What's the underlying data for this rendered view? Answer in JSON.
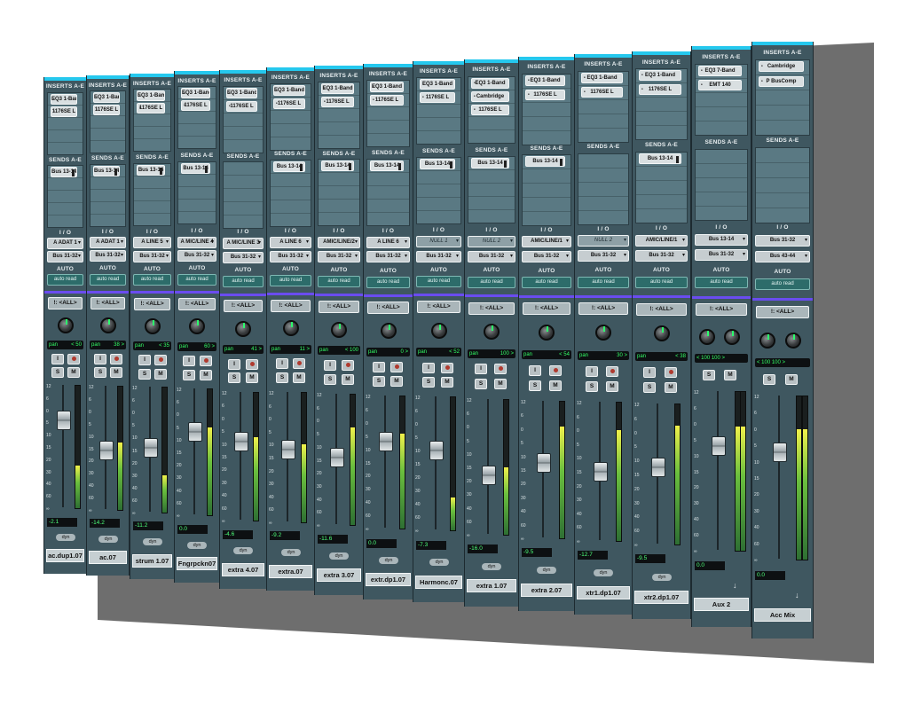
{
  "labels": {
    "inserts": "INSERTS A-E",
    "sends": "SENDS A-E",
    "io": "I / O",
    "auto": "AUTO",
    "auto_mode": "auto read",
    "group": "!: <ALL>",
    "pan": "pan",
    "solo": "S",
    "mute": "M",
    "input": "I",
    "dyn": "dyn"
  },
  "colors": {
    "strip_bg": "#3f5760",
    "header_accent": "#25c8ee",
    "separator": "#6a4cf0",
    "display_text": "#33ff66"
  },
  "channels": [
    {
      "name": "ac.dup1.07",
      "inserts": [
        "EQ3 1-Band",
        "1176SE L"
      ],
      "send": "Bus 13-14",
      "io_in": "A ADAT 1",
      "io_out": "Bus 31-32",
      "pan": "< 50",
      "volume": "-2.1",
      "level": 0.72,
      "meter": 0.35
    },
    {
      "name": "ac.07",
      "inserts": [
        "EQ3 1-Band",
        "1176SE L"
      ],
      "send": "Bus 13-14",
      "io_in": "A ADAT 1",
      "io_out": "Bus 31-32",
      "pan": "38 >",
      "volume": "-14.2",
      "level": 0.48,
      "meter": 0.55
    },
    {
      "name": "strum 1.07",
      "inserts": [
        "EQ3 1-Band",
        "1176SE L"
      ],
      "send": "Bus 13-14",
      "io_in": "A LINE 5",
      "io_out": "Bus 31-32",
      "pan": "< 35",
      "volume": "-11.2",
      "level": 0.52,
      "meter": 0.3
    },
    {
      "name": "Fngrpckn07",
      "inserts": [
        "EQ3 1-Band",
        "1176SE L"
      ],
      "send": "Bus 13-14",
      "io_in": "A MIC/LINE 4",
      "io_out": "Bus 31-32",
      "pan": "60 >",
      "volume": "0.0",
      "level": 0.66,
      "meter": 0.7
    },
    {
      "name": "extra 4.07",
      "inserts": [
        "EQ3 1-Band",
        "1176SE L"
      ],
      "send": "",
      "io_in": "A MIC/LINE 3",
      "io_out": "Bus 31-32",
      "pan": "41 >",
      "volume": "-4.6",
      "level": 0.62,
      "meter": 0.65
    },
    {
      "name": "extra.07",
      "inserts": [
        "EQ3 1-Band",
        "1176SE L"
      ],
      "send": "Bus 13-14",
      "io_in": "A LINE 6",
      "io_out": "Bus 31-32",
      "pan": "11 >",
      "volume": "-9.2",
      "level": 0.56,
      "meter": 0.6
    },
    {
      "name": "extra 3.07",
      "inserts": [
        "EQ3 1-Band",
        "1176SE L"
      ],
      "send": "Bus 13-14",
      "io_in": "AMIC/LINE/2",
      "io_out": "Bus 31-32",
      "pan": "< 100",
      "volume": "-11.6",
      "level": 0.52,
      "meter": 0.75
    },
    {
      "name": "extr.dp1.07",
      "inserts": [
        "EQ3 1-Band",
        "1176SE L"
      ],
      "send": "Bus 13-14",
      "io_in": "A LINE 6",
      "io_out": "Bus 31-32",
      "pan": "0 >",
      "volume": "0.0",
      "level": 0.66,
      "meter": 0.72
    },
    {
      "name": "Harmonc.07",
      "inserts": [
        "EQ3 1-Band",
        "1176SE L"
      ],
      "send": "Bus 13-14",
      "io_in": "NULL 1",
      "io_out": "Bus 31-32",
      "pan": "< 52",
      "volume": "-7.3",
      "level": 0.6,
      "meter": 0.25
    },
    {
      "name": "extra 1.07",
      "inserts": [
        "EQ3 1-Band",
        "Cambridge",
        "1176SE L"
      ],
      "send": "Bus 13-14",
      "io_in": "NULL 2",
      "io_out": "Bus 31-32",
      "pan": "100 >",
      "volume": "-16.0",
      "level": 0.44,
      "meter": 0.5
    },
    {
      "name": "extra 2.07",
      "inserts": [
        "EQ3 1-Band",
        "1176SE L"
      ],
      "send": "Bus 13-14",
      "io_in": "AMIC/LINE/1",
      "io_out": "Bus 31-32",
      "pan": "< 54",
      "volume": "-9.5",
      "level": 0.55,
      "meter": 0.82
    },
    {
      "name": "xtr1.dp1.07",
      "inserts": [
        "EQ3 1-Band",
        "1176SE L"
      ],
      "send": "",
      "io_in": "NULL 2",
      "io_out": "Bus 31-32",
      "pan": "30 >",
      "volume": "-12.7",
      "level": 0.5,
      "meter": 0.8
    },
    {
      "name": "xtr2.dp1.07",
      "inserts": [
        "EQ3 1-Band",
        "1176SE L"
      ],
      "send": "Bus 13-14",
      "io_in": "AMIC/LINE/1",
      "io_out": "Bus 31-32",
      "pan": "< 38",
      "volume": "-9.5",
      "level": 0.55,
      "meter": 0.85
    },
    {
      "name": "Aux 2",
      "inserts": [
        "EQ3 7-Band",
        "EMT 140"
      ],
      "send": "",
      "io_in": "Bus 13-14",
      "io_out": "Bus 31-32",
      "pan": "< 100 100 >",
      "volume": "0.0",
      "level": 0.66,
      "meter": 0.78,
      "stereo": true
    },
    {
      "name": "Acc Mix",
      "inserts": [
        "Cambridge",
        "P BusComp"
      ],
      "send": "",
      "io_in": "Bus 31-32",
      "io_out": "Bus 43-44",
      "pan": "< 100 100 >",
      "volume": "0.0",
      "level": 0.66,
      "meter": 0.8,
      "stereo": true
    }
  ]
}
